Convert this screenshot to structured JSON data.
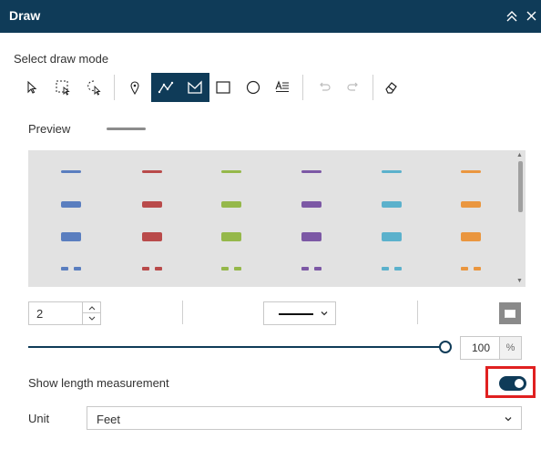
{
  "window": {
    "title": "Draw"
  },
  "draw_mode": {
    "title": "Select draw mode"
  },
  "preview": {
    "label": "Preview"
  },
  "colors": {
    "header": "#0f3b58",
    "swatches": [
      "#5a7ebf",
      "#b94a4a",
      "#95b84a",
      "#7c58a5",
      "#5bb1cc",
      "#ea963f"
    ]
  },
  "width_input": {
    "value": "2"
  },
  "transparency": {
    "value": "100",
    "unit": "%",
    "level_percent": 100
  },
  "length_measurement": {
    "label": "Show length measurement",
    "enabled": true
  },
  "unit": {
    "label": "Unit",
    "selected": "Feet"
  }
}
